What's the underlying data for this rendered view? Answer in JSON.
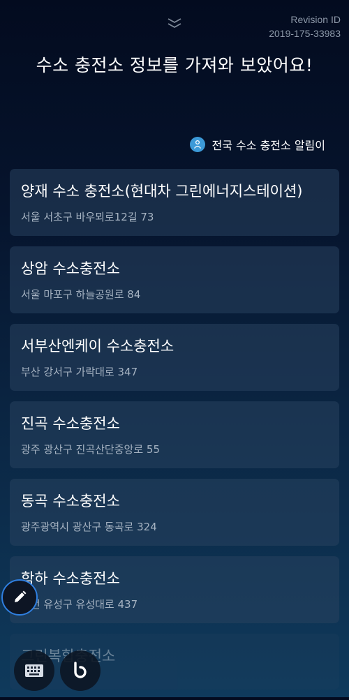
{
  "header": {
    "revision_label": "Revision ID",
    "revision_value": "2019-175-33983",
    "headline": "수소 충전소 정보를 가져와 보았어요!"
  },
  "source": {
    "label": "전국 수소 충전소 알림이",
    "icon": "station-app-icon",
    "icon_color": "#3c9ad8"
  },
  "stations": [
    {
      "name": "양재 수소 충전소(현대차 그린에너지스테이션)",
      "address": "서울 서초구 바우뫼로12길 73"
    },
    {
      "name": "상암 수소충전소",
      "address": "서울 마포구 하늘공원로 84"
    },
    {
      "name": "서부산엔케이 수소충전소",
      "address": "부산 강서구 가락대로 347"
    },
    {
      "name": "진곡 수소충전소",
      "address": "광주 광산구 진곡산단중앙로 55"
    },
    {
      "name": "동곡 수소충전소",
      "address": "광주광역시 광산구 동곡로 324"
    },
    {
      "name": "학하 수소충전소",
      "address": "대전 유성구 유성대로 437"
    },
    {
      "name": "그린복합충전소",
      "address": ""
    }
  ],
  "floating": {
    "edit_icon": "pencil-icon",
    "keyboard_icon": "keyboard-icon",
    "bixby_icon": "bixby-icon",
    "accent": "#2f7fe0"
  }
}
